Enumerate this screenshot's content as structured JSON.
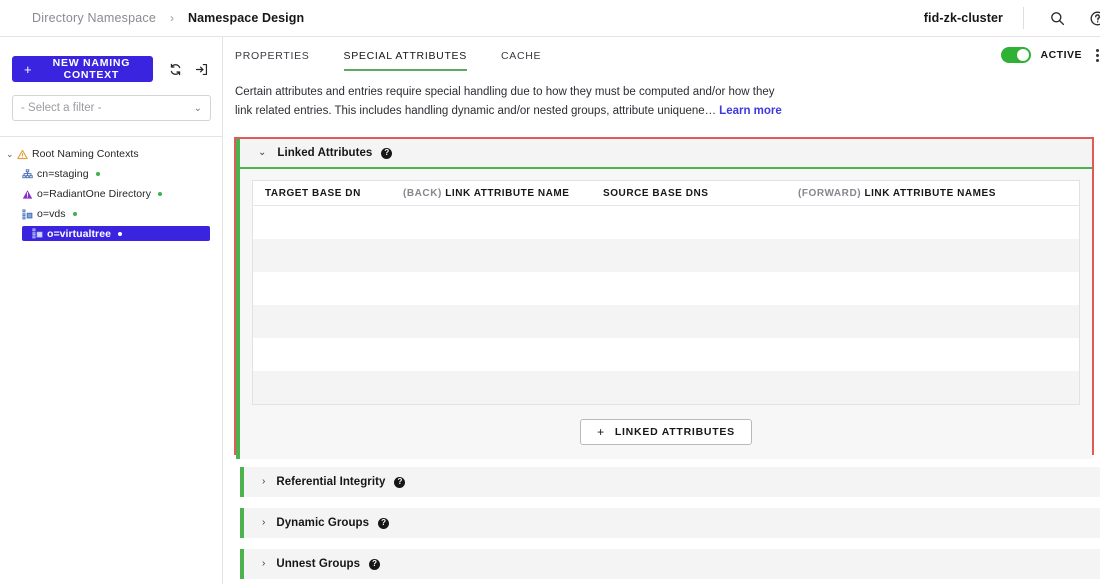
{
  "topbar": {
    "breadcrumb": {
      "parent": "Directory Namespace",
      "separator": "›",
      "current": "Namespace Design"
    },
    "cluster_name": "fid-zk-cluster",
    "icons": [
      {
        "name": "search-icon",
        "label": "Search"
      },
      {
        "name": "help-circle-icon",
        "label": "Help"
      }
    ]
  },
  "sidebar": {
    "new_context_button": "NEW NAMING CONTEXT",
    "plus_glyph": "+",
    "refresh_icon": "refresh-icon",
    "import_icon": "import-icon",
    "filter": {
      "placeholder": "- Select a filter -",
      "value": "- Select a filter -",
      "chevron": "⌄"
    },
    "tree": {
      "root": {
        "label": "Root Naming Contexts",
        "icon": "warning-triangle-icon",
        "expanded": true,
        "chevron": "⌄"
      },
      "items": [
        {
          "label": "cn=staging",
          "icon": "hierarchy-icon",
          "status": "green",
          "selected": false
        },
        {
          "label": "o=RadiantOne Directory",
          "icon": "purple-triangle-icon",
          "status": "green",
          "selected": false
        },
        {
          "label": "o=vds",
          "icon": "hierarchy-node-icon",
          "status": "green",
          "selected": false
        },
        {
          "label": "o=virtualtree",
          "icon": "hierarchy-node-icon",
          "status": "green",
          "selected": true
        }
      ]
    }
  },
  "main": {
    "tabs": [
      {
        "label": "PROPERTIES",
        "active": false
      },
      {
        "label": "SPECIAL ATTRIBUTES",
        "active": true
      },
      {
        "label": "CACHE",
        "active": false
      }
    ],
    "toggle": {
      "label": "ACTIVE",
      "on": true
    },
    "kebab_icon": "more-options-icon",
    "intro": {
      "line1": "Certain attributes and entries require special handling due to how they must be computed and/or how they",
      "line2": "link related entries. This includes handling dynamic and/or nested groups, attribute uniquene…",
      "learn_more": "Learn more"
    },
    "sections": [
      {
        "title": "Linked Attributes",
        "expanded": true,
        "chevron": "⌄",
        "help_glyph": "?",
        "highlighted": true,
        "table": {
          "columns": [
            {
              "prefix": "",
              "label": "TARGET BASE DN"
            },
            {
              "prefix": "(BACK)",
              "label": "LINK ATTRIBUTE NAME"
            },
            {
              "prefix": "",
              "label": "SOURCE BASE DNS"
            },
            {
              "prefix": "(FORWARD)",
              "label": "LINK ATTRIBUTE NAMES"
            }
          ],
          "rows": [],
          "empty_row_count": 6
        },
        "add_button": {
          "label": "LINKED ATTRIBUTES",
          "plus": "+"
        }
      },
      {
        "title": "Referential Integrity",
        "expanded": false,
        "chevron": "›",
        "help_glyph": "?"
      },
      {
        "title": "Dynamic Groups",
        "expanded": false,
        "chevron": "›",
        "help_glyph": "?"
      },
      {
        "title": "Unnest Groups",
        "expanded": false,
        "chevron": "›",
        "help_glyph": "?"
      }
    ]
  },
  "colors": {
    "primary_blue": "#3a24e0",
    "accent_green": "#4db24d",
    "toggle_green": "#2eb135",
    "highlight_red": "#e05b58",
    "link_blue": "#3b3bdd",
    "status_dot_green": "#3cb24b"
  }
}
